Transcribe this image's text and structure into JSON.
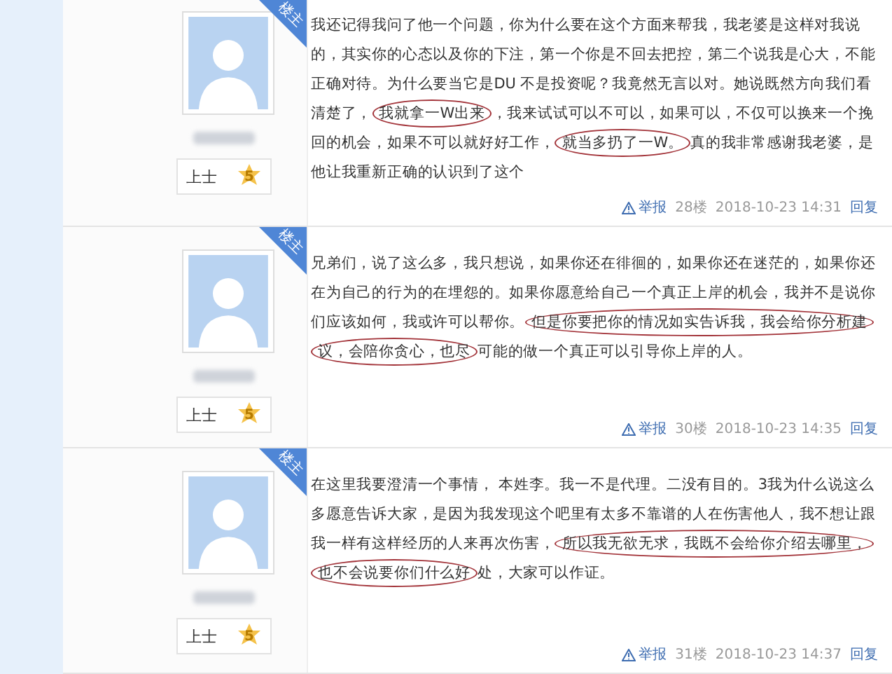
{
  "posts": [
    {
      "badge": "楼主",
      "rank": "上士",
      "level": "5",
      "segments": [
        {
          "text": "我还记得我问了他一个问题，你为什么要在这个方面来帮我，我老婆是这样对我说的，其实你的心态以及你的下注，第一个你是不回去把控，第二个说我是心大，不能正确对待。为什么要当它是DU 不是投资呢？我竟然无言以对。她说既然方向我们看清楚了，",
          "circled": false
        },
        {
          "text": "我就拿一W出来",
          "circled": true
        },
        {
          "text": "，我来试试可以不可以，如果可以，不仅可以换来一个挽回的机会，如果不可以就好好工作，",
          "circled": false
        },
        {
          "text": "就当多扔了一W。",
          "circled": true
        },
        {
          "text": "真的我非常感谢我老婆，是他让我重新正确的认识到了这个",
          "circled": false
        }
      ],
      "report": "举报",
      "floor": "28楼",
      "time": "2018-10-23 14:31",
      "reply": "回复"
    },
    {
      "badge": "楼主",
      "rank": "上士",
      "level": "5",
      "segments": [
        {
          "text": "兄弟们，说了这么多，我只想说，如果你还在徘徊的，如果你还在迷茫的，如果你还在为自己的行为的在埋怨的。如果你愿意给自己一个真正上岸的机会，我并不是说你们应该如何，我或许可以帮你。",
          "circled": false
        },
        {
          "text": "但是你要把你的情况如实告诉我，我会给你分析建议，会陪你贪心，也尽",
          "circled": true
        },
        {
          "text": "可能的做一个真正可以引导你上岸的人。",
          "circled": false
        }
      ],
      "report": "举报",
      "floor": "30楼",
      "time": "2018-10-23 14:35",
      "reply": "回复"
    },
    {
      "badge": "楼主",
      "rank": "上士",
      "level": "5",
      "segments": [
        {
          "text": "在这里我要澄清一个事情， 本姓李。我一不是代理。二没有目的。3我为什么说这么多愿意告诉大家，是因为我发现这个吧里有太多不靠谱的人在伤害他人，我不想让跟我一样有这样经历的人来再次伤害，",
          "circled": false
        },
        {
          "text": "所以我无欲无求，我既不会给你介绍去哪里，也不会说要你们什么好",
          "circled": true
        },
        {
          "text": "处，大家可以作证。",
          "circled": false
        }
      ],
      "report": "举报",
      "floor": "31楼",
      "time": "2018-10-23 14:37",
      "reply": "回复"
    }
  ]
}
